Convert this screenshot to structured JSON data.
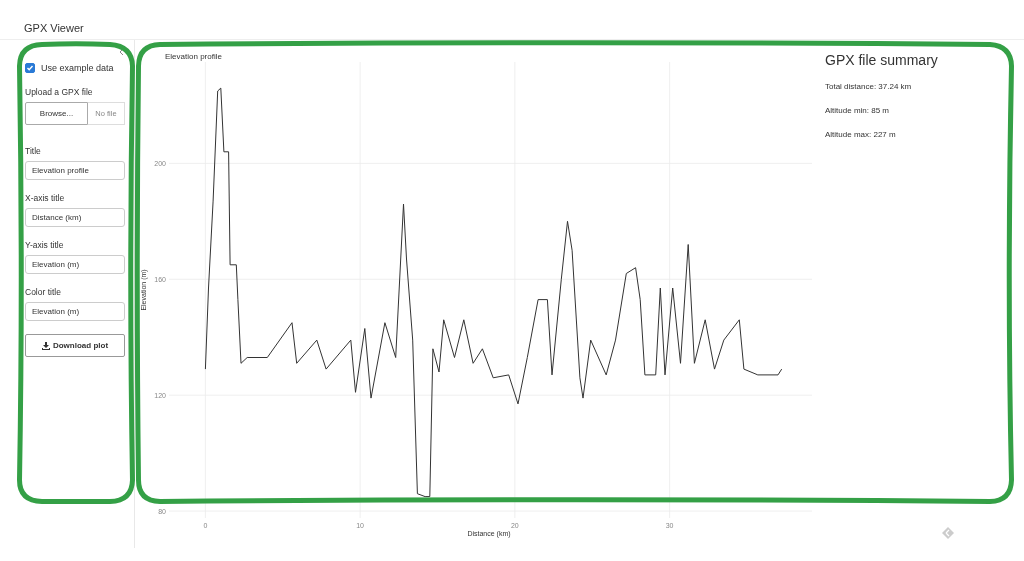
{
  "app": {
    "title": "GPX Viewer"
  },
  "sidebar": {
    "use_example": {
      "label": "Use example data",
      "checked": true
    },
    "upload": {
      "label": "Upload a GPX file",
      "button": "Browse...",
      "placeholder": "No file"
    },
    "fields": [
      {
        "label": "Title",
        "value": "Elevation profile"
      },
      {
        "label": "X-axis title",
        "value": "Distance (km)"
      },
      {
        "label": "Y-axis title",
        "value": "Elevation (m)"
      },
      {
        "label": "Color title",
        "value": "Elevation (m)"
      }
    ],
    "download_button": "Download plot"
  },
  "plot": {
    "chart_data": {
      "type": "line",
      "title": "Elevation profile",
      "xlabel": "Distance (km)",
      "ylabel": "Elevation (m)",
      "x": [
        0,
        0.2,
        0.5,
        0.8,
        1.0,
        1.2,
        1.5,
        1.6,
        2.0,
        2.1,
        2.3,
        2.7,
        4.0,
        5.6,
        5.9,
        7.2,
        7.8,
        9.4,
        9.7,
        10.3,
        10.7,
        11.6,
        12.3,
        12.8,
        13.0,
        13.4,
        13.7,
        14.2,
        14.5,
        14.7,
        15.1,
        15.4,
        16.1,
        16.7,
        17.3,
        17.9,
        18.6,
        19.6,
        20.2,
        20.8,
        21.5,
        22.1,
        22.4,
        23.0,
        23.4,
        23.7,
        24.2,
        24.4,
        24.9,
        25.9,
        26.5,
        27.2,
        27.8,
        28.1,
        28.4,
        29.1,
        29.4,
        29.7,
        30.2,
        30.7,
        31.2,
        31.6,
        32.3,
        32.9,
        33.5,
        34.5,
        34.8,
        35.7,
        37.0,
        37.24
      ],
      "xlim": [
        -2.35,
        39.2
      ],
      "series": [
        {
          "color": "#333333",
          "values": [
            129,
            157,
            187,
            225,
            226,
            204,
            204,
            165,
            165,
            153,
            131,
            133,
            133,
            145,
            131,
            139,
            129,
            139,
            121,
            143,
            119,
            145,
            133,
            186,
            167,
            139,
            86,
            85,
            85,
            136,
            128,
            146,
            133,
            146,
            131,
            136,
            126,
            127,
            117,
            133,
            153,
            153,
            127,
            160,
            180,
            170,
            126,
            119,
            139,
            127,
            139,
            162,
            164,
            153,
            127,
            127,
            157,
            127,
            157,
            131,
            172,
            131,
            146,
            129,
            139,
            146,
            129,
            127,
            127,
            129
          ]
        }
      ],
      "ylim": [
        77.6,
        235
      ],
      "xticks": [
        0,
        10,
        20,
        30
      ],
      "yticks": [
        80,
        120,
        160,
        200
      ],
      "grid": true
    }
  },
  "summary": {
    "title": "GPX file summary",
    "lines": [
      "Total distance: 37.24 km",
      "Altitude min: 85 m",
      "Altitude max: 227 m"
    ]
  }
}
